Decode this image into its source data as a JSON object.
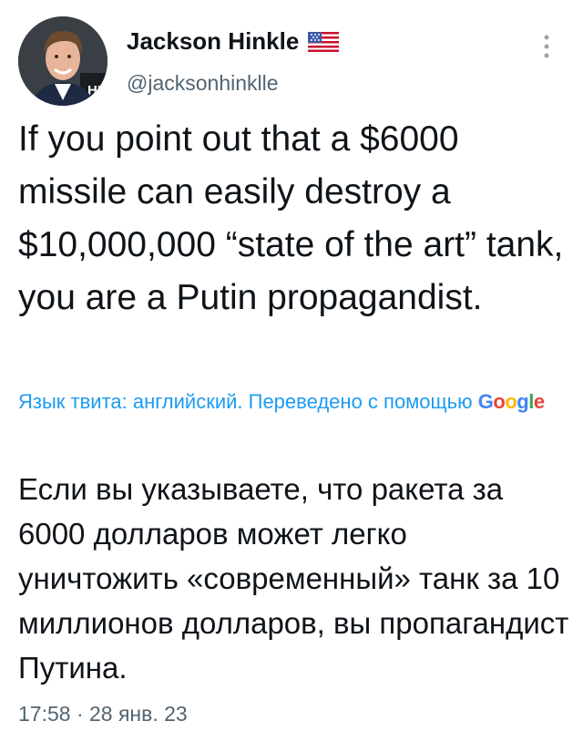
{
  "author": {
    "name": "Jackson Hinkle",
    "handle": "@jacksonhinklle",
    "flag_icon": "us-flag-icon"
  },
  "tweet": {
    "text": "If you point out that a $6000 missile can easily destroy a $10,000,000 “state of the art” tank, you are a Putin propagandist."
  },
  "translation": {
    "notice": "Язык твита: английский. Переведено с помощью",
    "provider": "Google",
    "text": "Если вы указываете, что ракета за 6000 долларов может легко уничтожить «современный» танк за 10 миллионов долларов, вы пропагандист Путина."
  },
  "meta": {
    "timestamp": "17:58 · 28 янв. 23"
  },
  "colors": {
    "link": "#1d9bf0",
    "secondary_text": "#536471",
    "primary_text": "#0f1419"
  }
}
